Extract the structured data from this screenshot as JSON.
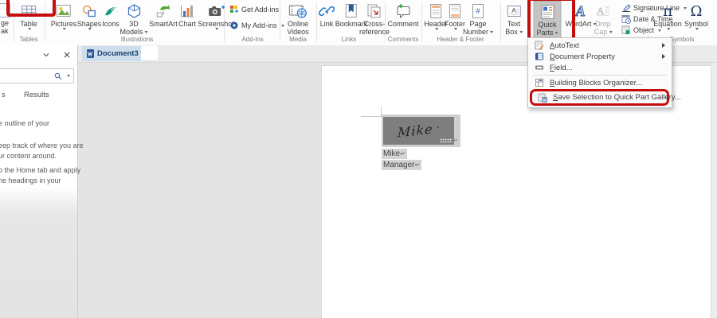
{
  "tabbar": {
    "title": "Document3 *"
  },
  "ribbon": {
    "partial": {
      "l1": "ge",
      "l2": "ak"
    },
    "tables": {
      "group": "Tables",
      "table": "Table"
    },
    "illustrations": {
      "group": "Illustrations",
      "pictures": "Pictures",
      "shapes": "Shapes",
      "icons": "Icons",
      "m1": "3D",
      "m2": "Models",
      "smartart": "SmartArt",
      "chart": "Chart",
      "screenshot": "Screenshot"
    },
    "addins": {
      "group": "Add-ins",
      "get": "Get Add-ins",
      "my": "My Add-ins"
    },
    "media": {
      "group": "Media",
      "o1": "Online",
      "o2": "Videos"
    },
    "links": {
      "group": "Links",
      "link": "Link",
      "bookmark": "Bookmark",
      "c1": "Cross-",
      "c2": "reference"
    },
    "comments": {
      "group": "Comments",
      "comment": "Comment"
    },
    "hf": {
      "group": "Header & Footer",
      "header": "Header",
      "footer": "Footer",
      "p1": "Page",
      "p2": "Number"
    },
    "text": {
      "t1": "Text",
      "t2": "Box",
      "q1": "Quick",
      "q2": "Parts",
      "wordart": "WordArt",
      "d1": "Drop",
      "d2": "Cap",
      "signature": "Signature Line",
      "datetime": "Date & Time",
      "object": "Object"
    },
    "symbols": {
      "group": "Symbols",
      "equation": "Equation",
      "symbol": "Symbol"
    }
  },
  "sidebar": {
    "tab_partial": "s",
    "tab_results": "Results",
    "p1": "e outline of your",
    "p2": "eep track of where you are",
    "p3": "ur content around.",
    "p4": "o the Home tab and apply",
    "p5": "he headings in your"
  },
  "quickparts_menu": {
    "autotext": "AutoText",
    "docprop": "Document Property",
    "field": "Field...",
    "organizer": "Building Blocks Organizer...",
    "save": "Save Selection to Quick Part Gallery..."
  },
  "document": {
    "signature": "Mike",
    "sig_dot": "·",
    "line1": "Mike",
    "line2": "Manager",
    "pmark": "↵"
  },
  "colors": {
    "highlight_red": "#c40d0d",
    "word_blue": "#2b579a",
    "tab_active_bg": "#cfdeed"
  }
}
